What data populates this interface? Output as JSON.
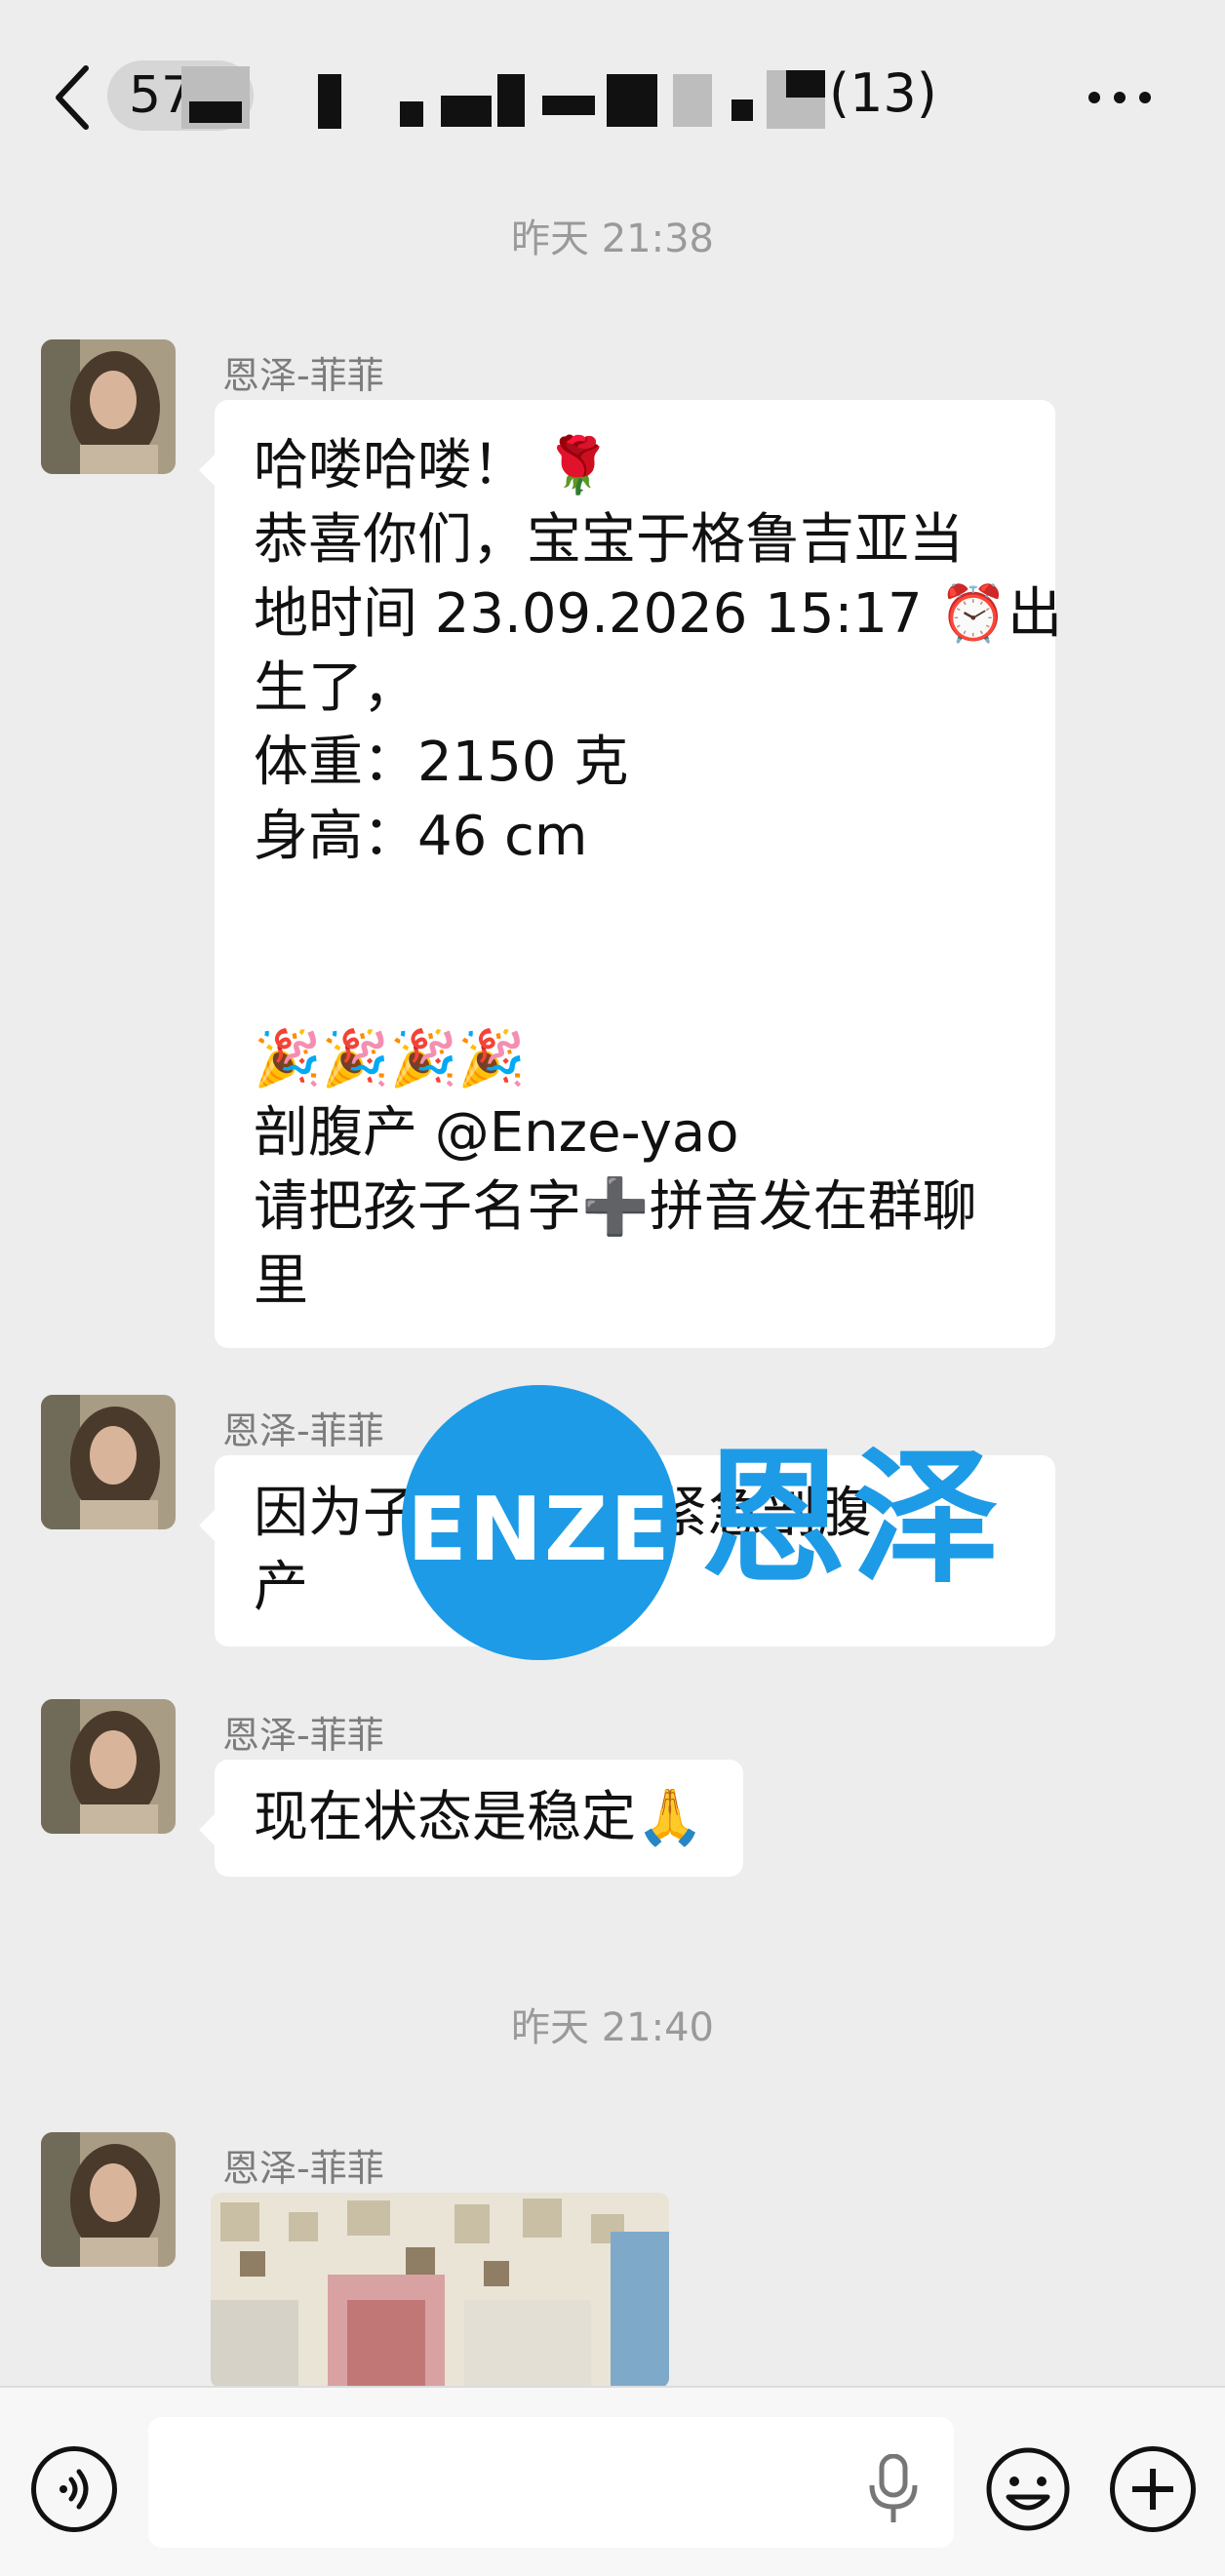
{
  "header": {
    "title_visible_prefix": "57",
    "member_count": "(13)",
    "back_icon": "chevron-left-icon",
    "more_icon": "more-dots-icon"
  },
  "messages": [
    {
      "time": "昨天 21:38",
      "sender": "恩泽-菲菲",
      "lines": [
        "哈喽哈喽！ 🌹",
        "恭喜你们，宝宝于格鲁吉亚当",
        "地时间 23.09.2026 15:17 ⏰出",
        "生了，",
        "体重：2150 克",
        "身高：46 cm",
        "",
        "",
        "🎉🎉🎉🎉",
        "剖腹产 @Enze-yao",
        "请把孩子名字➕拼音发在群聊",
        "里"
      ]
    },
    {
      "sender": "恩泽-菲菲",
      "lines": [
        "因为子宫破裂 故紧急剖腹",
        "产"
      ]
    },
    {
      "sender": "恩泽-菲菲",
      "lines": [
        "现在状态是稳定🙏"
      ]
    },
    {
      "time": "昨天 21:40",
      "sender": "恩泽-菲菲",
      "image": "photo-message"
    }
  ],
  "watermark": {
    "latin": "ENZE",
    "chinese": "恩泽"
  },
  "input": {
    "placeholder": "",
    "voice_icon": "voice-icon",
    "mic_icon": "microphone-icon",
    "emoji_icon": "emoji-smile-icon",
    "plus_icon": "plus-icon"
  },
  "colors": {
    "background": "#ededed",
    "bubble": "#ffffff",
    "watermark_blue": "#1e9be6",
    "timestamp": "#9a9a9a",
    "sender": "#7c7c7c"
  }
}
